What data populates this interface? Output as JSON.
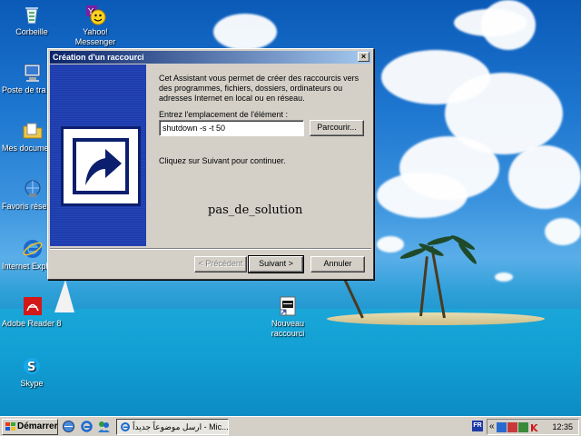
{
  "desktop": {
    "icons": [
      {
        "label": "Corbeille"
      },
      {
        "label": "Yahoo!",
        "label2": "Messenger"
      },
      {
        "label": "Poste de tra"
      },
      {
        "label": "Mes docume"
      },
      {
        "label": "Favoris rése"
      },
      {
        "label": "Internet Expl"
      },
      {
        "label": "Adobe Reader 8"
      },
      {
        "label": "Skype"
      },
      {
        "label": "Nouveau",
        "label2": "raccourci"
      }
    ]
  },
  "dialog": {
    "title": "Création d'un raccourci",
    "intro": "Cet Assistant vous permet de créer des raccourcis vers des programmes, fichiers, dossiers, ordinateurs ou adresses Internet en local ou en réseau.",
    "field_label": "Entrez l'emplacement de l'élément :",
    "location_value": "shutdown -s -t 50",
    "browse_label": "Parcourir...",
    "hint": "Cliquez sur Suivant pour continuer.",
    "watermark": "pas_de_solution",
    "back_label": "< Précédent",
    "next_label": "Suivant >",
    "cancel_label": "Annuler",
    "close_glyph": "×"
  },
  "taskbar": {
    "start_label": "Démarrer",
    "task_label": "ارسل موضوعاً جديداً - Mic...",
    "lang": "FR",
    "tray_expand": "«",
    "clock": "12:35"
  },
  "colors": {
    "titlebar_start": "#0a246a",
    "titlebar_end": "#a6caf0",
    "panel_blue": "#1d3aa8",
    "face": "#d4d0c8"
  }
}
